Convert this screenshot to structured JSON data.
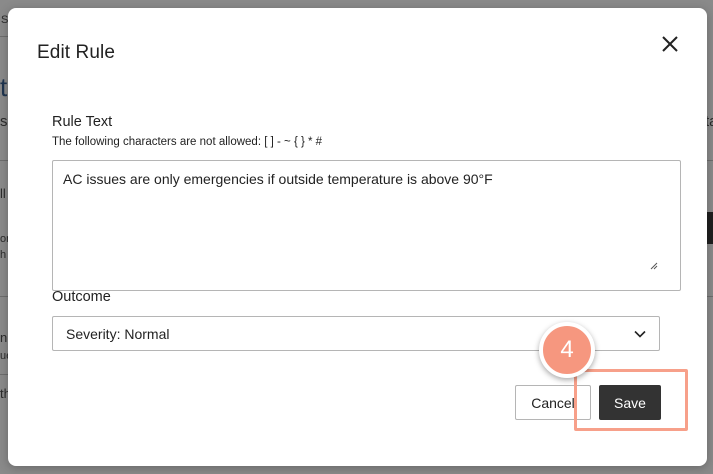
{
  "background": {
    "fragments": [
      "S",
      "t",
      "se",
      "ll",
      "or",
      "h",
      "n",
      "ue",
      "th",
      "ta"
    ]
  },
  "modal": {
    "title": "Edit Rule",
    "close_icon": "close-icon",
    "rule_text": {
      "label": "Rule Text",
      "hint": "The following characters are not allowed: [ ] - ~ { } * #",
      "value": "AC issues are only emergencies if outside temperature is above 90°F"
    },
    "outcome": {
      "label": "Outcome",
      "selected": "Severity: Normal",
      "chevron_icon": "chevron-down-icon"
    },
    "buttons": {
      "cancel": "Cancel",
      "save": "Save"
    }
  },
  "annotation": {
    "step_number": "4",
    "color": "#f6977f"
  }
}
